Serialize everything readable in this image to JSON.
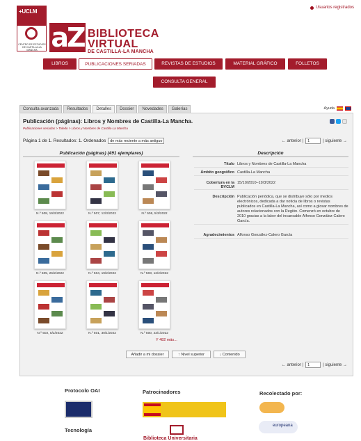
{
  "top_link": "Usuarios registrados",
  "uclm": {
    "short": "+UCLM",
    "center": "CENTRO DE ESTUDIOS DE CASTILLA-LA MANCHA"
  },
  "brand": {
    "logo": "aZ",
    "line1": "BIBLIOTECA",
    "line2": "VIRTUAL",
    "line3": "DE CASTILLA-LA MANCHA"
  },
  "nav": [
    "LIBROS",
    "PUBLICACIONES SERIADAS",
    "REVISTAS DE ESTUDIOS",
    "MATERIAL GRÁFICO",
    "FOLLETOS",
    "CONSULTA GENERAL"
  ],
  "tabs": [
    "Consulta avanzada",
    "Resultados",
    "Detalles",
    "Dossier",
    "Novedades",
    "Galerías"
  ],
  "help": "Ayuda",
  "title": "Publicación (páginas): Libros y Nombres de Castilla-La Mancha.",
  "breadcrumb": "Publicaciones seriadas > Toledo > Libros y Nombres de Castilla-La Mancha",
  "pager": {
    "text": "Página 1 de 1. Resultados: 1. Ordenados",
    "sort": "de más reciente a más antiguo",
    "prev": "← anterior |",
    "page": "1",
    "next": "| siguiente →"
  },
  "left_head": "Publicación (páginas) (491 ejemplares)",
  "right_head": "Descripción",
  "thumbs": [
    "N.º 508, 19/3/2022",
    "N.º 507, 12/3/2022",
    "N.º 506, 5/3/2022",
    "N.º 505, 26/2/2022",
    "N.º 504, 19/2/2022",
    "N.º 503, 12/2/2022",
    "N.º 502, 5/2/2022",
    "N.º 501, 30/1/2022",
    "N.º 500, 23/1/2022"
  ],
  "more": "Y 482 más...",
  "details": [
    {
      "k": "Título",
      "v": "Libros y Nombres de Castilla-La Mancha"
    },
    {
      "k": "Ámbito geográfico",
      "v": "Castilla-La Mancha"
    },
    {
      "k": "Cobertura en la BVCLM",
      "v": "15/10/2010–19/3/2022"
    },
    {
      "k": "Descripción",
      "v": "Publicación periódica, que se distribuye sólo por medios electrónicos, dedicada a dar noticia de libros o revistas publicados en Castilla-La Mancha, así como a glosar nombres de autores relacionados con la Región. Comenzó en octubre de 2010 gracias a la labor del incansable Alfonso González-Calero García."
    },
    {
      "k": "Agradecimientos",
      "v": "Alfonso González-Calero García"
    }
  ],
  "actions": [
    "Añadir a mi dossier",
    "↑ Nivel superior",
    "↓ Contenido"
  ],
  "footer": {
    "oai": "Protocolo OAI",
    "sponsors": "Patrocinadores",
    "harvested": "Recolectado por:",
    "tech": "Tecnología",
    "bu": "Biblioteca Universitaria",
    "europeana": "europeana"
  },
  "colors": {
    "brand": "#a31c2c",
    "panel": "#f1f1f1"
  }
}
